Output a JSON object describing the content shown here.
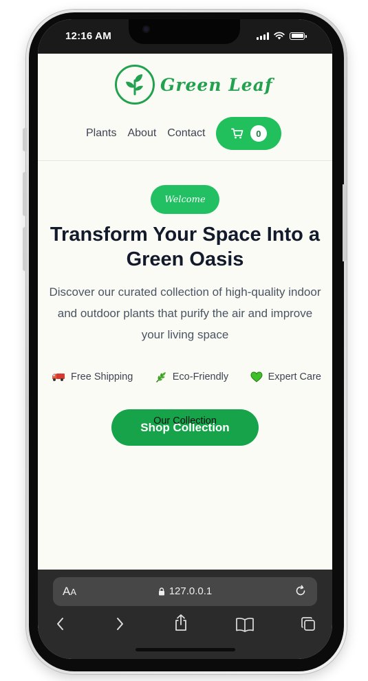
{
  "status_bar": {
    "time": "12:16 AM"
  },
  "header": {
    "brand": "Green Leaf",
    "nav": [
      {
        "label": "Plants"
      },
      {
        "label": "About"
      },
      {
        "label": "Contact"
      }
    ],
    "cart": {
      "count": "0",
      "icon": "cart-icon"
    }
  },
  "hero": {
    "badge": "Welcome",
    "title": "Transform Your Space Into a Green Oasis",
    "subtitle": "Discover our curated collection of high-quality indoor and outdoor plants that purify the air and improve your living space",
    "features": [
      {
        "icon": "truck-icon",
        "label": "Free Shipping"
      },
      {
        "icon": "herb-icon",
        "label": "Eco-Friendly"
      },
      {
        "icon": "green-heart-icon",
        "label": "Expert Care"
      }
    ],
    "cta": "Shop Collection"
  },
  "section": {
    "heading": "Our Collection"
  },
  "browser": {
    "aa_label": "A",
    "aa_small": "A",
    "url": "127.0.0.1"
  },
  "colors": {
    "brand_green": "#22a14f",
    "cart_green": "#21c05c",
    "cta_green": "#16a34a",
    "text_dark": "#121a2b",
    "page_bg": "#fbfbf6"
  }
}
